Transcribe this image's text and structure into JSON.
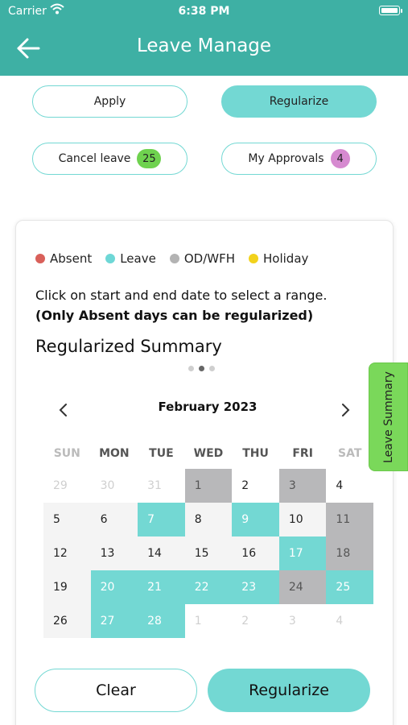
{
  "status_bar": {
    "carrier": "Carrier",
    "time": "6:38 PM"
  },
  "header": {
    "title": "Leave Manage"
  },
  "actions": {
    "apply": "Apply",
    "regularize": "Regularize",
    "cancel_leave": "Cancel leave",
    "cancel_leave_count": "25",
    "my_approvals": "My Approvals",
    "my_approvals_count": "4"
  },
  "legend": [
    {
      "label": "Absent",
      "color": "#d9605a"
    },
    {
      "label": "Leave",
      "color": "#6ed7d6"
    },
    {
      "label": "OD/WFH",
      "color": "#b3b3b3"
    },
    {
      "label": "Holiday",
      "color": "#f2d21c"
    }
  ],
  "instructions": {
    "line1": "Click on start and end date to select a range.",
    "line2": "(Only Absent days can be regularized)"
  },
  "summary_title": "Regularized Summary",
  "calendar": {
    "month": "February 2023",
    "weekdays": [
      "SUN",
      "MON",
      "TUE",
      "WED",
      "THU",
      "FRI",
      "SAT"
    ],
    "weeks": [
      [
        {
          "d": "29",
          "t": "other"
        },
        {
          "d": "30",
          "t": "other"
        },
        {
          "d": "31",
          "t": "other"
        },
        {
          "d": "1",
          "t": "od"
        },
        {
          "d": "2",
          "t": "normal"
        },
        {
          "d": "3",
          "t": "od"
        },
        {
          "d": "4",
          "t": "normal"
        }
      ],
      [
        {
          "d": "5",
          "t": "normal"
        },
        {
          "d": "6",
          "t": "normal"
        },
        {
          "d": "7",
          "t": "leave"
        },
        {
          "d": "8",
          "t": "normal"
        },
        {
          "d": "9",
          "t": "leave"
        },
        {
          "d": "10",
          "t": "normal"
        },
        {
          "d": "11",
          "t": "od"
        }
      ],
      [
        {
          "d": "12",
          "t": "normal"
        },
        {
          "d": "13",
          "t": "normal"
        },
        {
          "d": "14",
          "t": "normal"
        },
        {
          "d": "15",
          "t": "normal"
        },
        {
          "d": "16",
          "t": "normal"
        },
        {
          "d": "17",
          "t": "leave"
        },
        {
          "d": "18",
          "t": "od"
        }
      ],
      [
        {
          "d": "19",
          "t": "normal"
        },
        {
          "d": "20",
          "t": "leave"
        },
        {
          "d": "21",
          "t": "leave"
        },
        {
          "d": "22",
          "t": "leave"
        },
        {
          "d": "23",
          "t": "leave"
        },
        {
          "d": "24",
          "t": "od"
        },
        {
          "d": "25",
          "t": "leave"
        }
      ],
      [
        {
          "d": "26",
          "t": "normal"
        },
        {
          "d": "27",
          "t": "leave"
        },
        {
          "d": "28",
          "t": "leave"
        },
        {
          "d": "1",
          "t": "other"
        },
        {
          "d": "2",
          "t": "other"
        },
        {
          "d": "3",
          "t": "other"
        },
        {
          "d": "4",
          "t": "other"
        }
      ]
    ]
  },
  "buttons": {
    "clear": "Clear",
    "regularize": "Regularize"
  },
  "side_tab": {
    "label": "Leave Summary"
  }
}
